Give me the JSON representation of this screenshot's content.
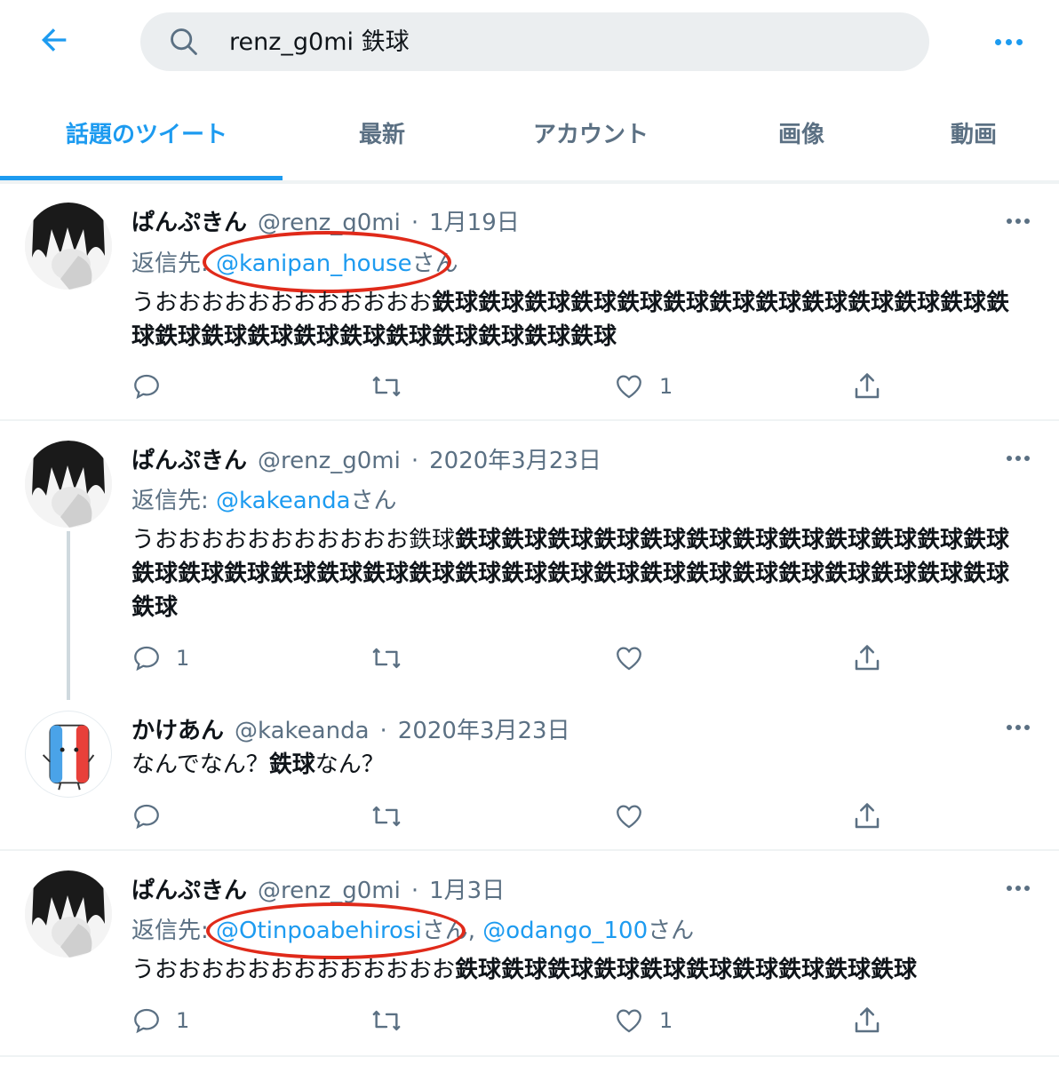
{
  "header": {
    "search_query": "renz_g0mi 鉄球"
  },
  "tabs": [
    {
      "label": "話題のツイート",
      "active": true
    },
    {
      "label": "最新"
    },
    {
      "label": "アカウント"
    },
    {
      "label": "画像"
    },
    {
      "label": "動画"
    }
  ],
  "tweets": [
    {
      "name": "ぱんぷきん",
      "handle": "@renz_g0mi",
      "sep": "·",
      "date": "1月19日",
      "reply_prefix": "返信先: ",
      "reply_to": "@kanipan_house",
      "reply_suffix": "さん",
      "text_plain": "うおおおおおおおおおおおお",
      "text_bold": "鉄球鉄球鉄球鉄球鉄球鉄球鉄球鉄球鉄球鉄球鉄球鉄球鉄球鉄球鉄球鉄球鉄球鉄球鉄球鉄球鉄球鉄球鉄球",
      "reply_count": "",
      "retweet_count": "",
      "like_count": "1"
    },
    {
      "name": "ぱんぷきん",
      "handle": "@renz_g0mi",
      "sep": "·",
      "date": "2020年3月23日",
      "reply_prefix": "返信先: ",
      "reply_to": "@kakeanda",
      "reply_suffix": "さん",
      "text_plain": "うおおおおおおおおおおお鉄球",
      "text_bold": "鉄球鉄球鉄球鉄球鉄球鉄球鉄球鉄球鉄球鉄球鉄球鉄球鉄球鉄球鉄球鉄球鉄球鉄球鉄球鉄球鉄球鉄球鉄球鉄球鉄球鉄球鉄球鉄球鉄球鉄球鉄球鉄球",
      "reply_count": "1",
      "retweet_count": "",
      "like_count": ""
    },
    {
      "name": "かけあん",
      "handle": "@kakeanda",
      "sep": "·",
      "date": "2020年3月23日",
      "text_a": "なんでなん？",
      "text_bold": "鉄球",
      "text_b": "なん？",
      "reply_count": "",
      "retweet_count": "",
      "like_count": ""
    },
    {
      "name": "ぱんぷきん",
      "handle": "@renz_g0mi",
      "sep": "·",
      "date": "1月3日",
      "reply_prefix": "返信先: ",
      "reply_to": "@Otinpoabehirosi",
      "reply_mid": "さん, ",
      "reply_to2": "@odango_100",
      "reply_suffix": "さん",
      "text_plain": "うおおおおおおおおおおおおお",
      "text_bold": "鉄球鉄球鉄球鉄球鉄球鉄球鉄球鉄球鉄球鉄球",
      "reply_count": "1",
      "retweet_count": "",
      "like_count": "1"
    }
  ],
  "colors": {
    "accent": "#1d9bf0",
    "secondary_text": "#5b7083",
    "annotation_red": "#e02a1a"
  },
  "icons": [
    "back-arrow-icon",
    "search-icon",
    "more-icon",
    "reply-icon",
    "retweet-icon",
    "like-icon",
    "share-icon"
  ]
}
